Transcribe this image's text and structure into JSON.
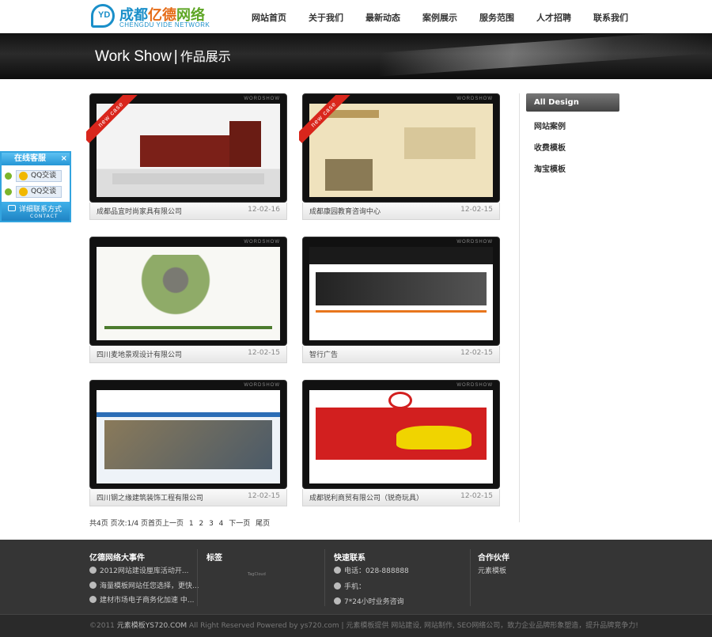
{
  "header": {
    "logo_cn_a": "成都",
    "logo_cn_b": "亿德",
    "logo_cn_c": "网络",
    "logo_en": "CHENGDU YIDE NETWORK",
    "logo_mark": "YD",
    "nav": [
      "网站首页",
      "关于我们",
      "最新动态",
      "案例展示",
      "服务范围",
      "人才招聘",
      "联系我们"
    ]
  },
  "banner": {
    "en": "Work Show",
    "sep": "|",
    "cn": "作品展示"
  },
  "works": [
    {
      "title": "成都品宜时尚家具有限公司",
      "date": "12-02-16",
      "ribbon": "new case"
    },
    {
      "title": "成都康园教育咨询中心",
      "date": "12-02-15",
      "ribbon": "new case"
    },
    {
      "title": "四川麦地景观设计有限公司",
      "date": "12-02-15",
      "ribbon": ""
    },
    {
      "title": "智行广告",
      "date": "12-02-15",
      "ribbon": ""
    },
    {
      "title": "四川钢之缘建筑装饰工程有限公司",
      "date": "12-02-15",
      "ribbon": ""
    },
    {
      "title": "成都锐利商贸有限公司（锐奇玩具）",
      "date": "12-02-15",
      "ribbon": ""
    }
  ],
  "thumb_tag": "WORDSHOW",
  "pager": {
    "info": "共4页 页次:1/4 页首页上一页",
    "pages": [
      "1",
      "2",
      "3",
      "4"
    ],
    "next": "下一页",
    "last": "尾页"
  },
  "sidebar": {
    "active": "All Design",
    "items": [
      "网站案例",
      "收费模板",
      "淘宝模板"
    ]
  },
  "service": {
    "title": "在线客服",
    "close": "×",
    "buttons": [
      "QQ交谈",
      "QQ交谈"
    ],
    "contact": "详细联系方式",
    "contact_en": "CONTACT"
  },
  "footer": {
    "events_title": "亿德网络大事件",
    "events": [
      "2012网站建设厘库活动开...",
      "海量模板网站任您选择，更快...",
      "建材市场电子商务化加速 中..."
    ],
    "tags_title": "标签",
    "tags_text": "TagCloud",
    "contact_title": "快速联系",
    "contact": [
      "电话：028-888888",
      "手机：",
      "7*24小时业务咨询"
    ],
    "partner_title": "合作伙伴",
    "partner": "元素模板",
    "copyright_a": "©2011",
    "copyright_b": "元素模板YS720.COM",
    "copyright_c": "All Right Reserved Powered by ys720.com | 元素模板提供 网站建设, 网站制作, SEO网络公司，致力企业品牌形象塑造，提升品牌竞争力!"
  },
  "colors": {
    "brand_blue": "#1a8fc9",
    "brand_orange": "#e56b16",
    "brand_green": "#5ea625",
    "ribbon_red": "#d9261c",
    "footer_bg": "#353535"
  }
}
